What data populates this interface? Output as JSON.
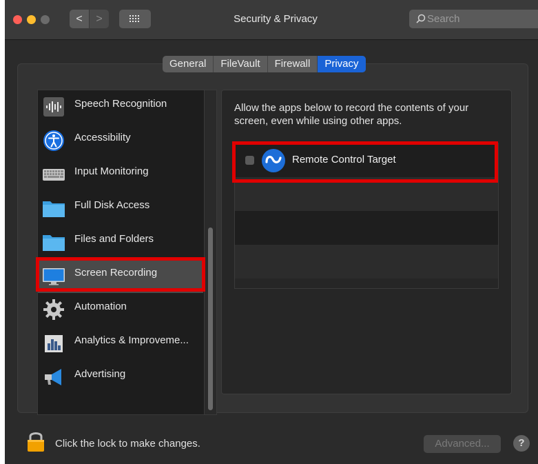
{
  "window": {
    "title": "Security & Privacy"
  },
  "toolbar": {
    "back_glyph": "<",
    "forward_glyph": ">",
    "search_placeholder": "Search"
  },
  "tabs": [
    {
      "label": "General",
      "active": false
    },
    {
      "label": "FileVault",
      "active": false
    },
    {
      "label": "Firewall",
      "active": false
    },
    {
      "label": "Privacy",
      "active": true
    }
  ],
  "sidebar": {
    "items": [
      {
        "label": "Speech Recognition",
        "icon": "waveform-icon"
      },
      {
        "label": "Accessibility",
        "icon": "accessibility-icon"
      },
      {
        "label": "Input Monitoring",
        "icon": "keyboard-icon"
      },
      {
        "label": "Full Disk Access",
        "icon": "folder-icon"
      },
      {
        "label": "Files and Folders",
        "icon": "folder-icon"
      },
      {
        "label": "Screen Recording",
        "icon": "display-icon",
        "selected": true
      },
      {
        "label": "Automation",
        "icon": "gear-icon"
      },
      {
        "label": "Analytics & Improveme...",
        "icon": "bar-chart-icon"
      },
      {
        "label": "Advertising",
        "icon": "megaphone-icon"
      }
    ]
  },
  "content": {
    "description": "Allow the apps below to record the contents of your screen, even while using other apps.",
    "apps": [
      {
        "name": "Remote Control Target",
        "checked": false,
        "icon": "remote-control-icon"
      }
    ]
  },
  "footer": {
    "lock_text": "Click the lock to make changes.",
    "advanced_label": "Advanced...",
    "help_label": "?"
  },
  "colors": {
    "accent": "#1a63d6",
    "highlight": "#e00000"
  }
}
